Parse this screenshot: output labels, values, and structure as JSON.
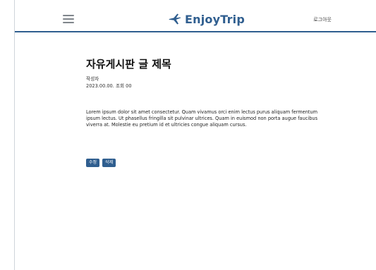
{
  "header": {
    "logo_text": "EnjoyTrip",
    "logout_label": "로그아웃",
    "menu_icon": "hamburger-menu-icon",
    "logo_icon": "airplane-icon",
    "accent_color": "#2f5e8f"
  },
  "post": {
    "title": "자유게시판 글 제목",
    "author": "작성자",
    "date_views": "2023.00.00. 조회 00",
    "body": "Lorem ipsum dolor sit amet consectetur. Quam vivamus orci enim lectus purus aliquam fermentum ipsum lectus. Ut phasellus fringilla sit pulvinar ultrices. Quam in euismod non porta augue faucibus viverra at. Molestie eu pretium id et ultricies congue aliquam cursus."
  },
  "actions": {
    "edit_label": "수정",
    "delete_label": "삭제"
  }
}
